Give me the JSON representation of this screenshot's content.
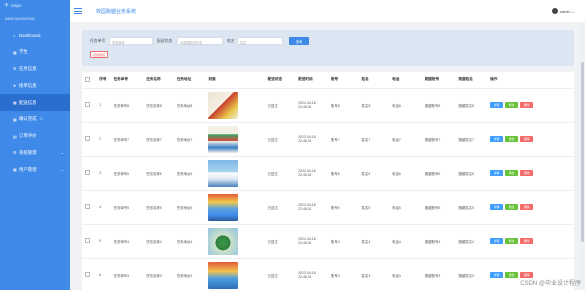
{
  "app": {
    "logo_text": "Sapo",
    "title": "校园跑腿业务系统",
    "user": "admin"
  },
  "sidebar": {
    "section_label": "MAIN NAVIGATION",
    "items": [
      {
        "label": "Dashboard",
        "icon": "home-icon"
      },
      {
        "label": "学生",
        "icon": "grid-icon"
      },
      {
        "label": "任务信息",
        "icon": "gear-icon"
      },
      {
        "label": "接单信息",
        "icon": "send-icon"
      },
      {
        "label": "配送信息",
        "icon": "grid-icon"
      },
      {
        "label": "确认完成",
        "icon": "grid-icon"
      },
      {
        "label": "订单评价",
        "icon": "doc-icon"
      },
      {
        "label": "系统管理",
        "icon": "gear-icon"
      },
      {
        "label": "用户管理",
        "icon": "grid-icon"
      }
    ]
  },
  "search": {
    "label_task_no": "任务单号",
    "placeholder_task_no": "任务单号",
    "label_delivery_status": "配送状态",
    "placeholder_delivery_status": "请选择配送状态",
    "label_name": "姓名",
    "placeholder_name": "姓名",
    "button": "查询",
    "delete_button": "批量删除"
  },
  "table": {
    "headers": [
      "序号",
      "任务单号",
      "任务名称",
      "任务地址",
      "封面",
      "配送状态",
      "配送时间",
      "账号",
      "姓名",
      "电话",
      "跑腿账号",
      "跑腿姓名",
      "操作"
    ],
    "rows": [
      {
        "idx": "1",
        "task_no": "任务单号8",
        "task_name": "任务名称8",
        "addr": "任务地址8",
        "status": "已送达",
        "time": "2022-04-18 22:46:31",
        "account": "账号8",
        "name": "姓名8",
        "phone": "电话8",
        "runner_acc": "跑腿账号8",
        "runner_name": "跑腿姓名8"
      },
      {
        "idx": "2",
        "task_no": "任务单号7",
        "task_name": "任务名称7",
        "addr": "任务地址7",
        "status": "已送达",
        "time": "2022-04-18 22:46:31",
        "account": "账号7",
        "name": "姓名7",
        "phone": "电话7",
        "runner_acc": "跑腿账号7",
        "runner_name": "跑腿姓名7"
      },
      {
        "idx": "3",
        "task_no": "任务单号6",
        "task_name": "任务名称6",
        "addr": "任务地址6",
        "status": "已送达",
        "time": "2022-04-18 22:46:31",
        "account": "账号6",
        "name": "姓名6",
        "phone": "电话6",
        "runner_acc": "跑腿账号6",
        "runner_name": "跑腿姓名6"
      },
      {
        "idx": "4",
        "task_no": "任务单号5",
        "task_name": "任务名称5",
        "addr": "任务地址5",
        "status": "已送达",
        "time": "2022-04-18 22:46:31",
        "account": "账号5",
        "name": "姓名5",
        "phone": "电话5",
        "runner_acc": "跑腿账号5",
        "runner_name": "跑腿姓名5"
      },
      {
        "idx": "5",
        "task_no": "任务单号4",
        "task_name": "任务名称4",
        "addr": "任务地址4",
        "status": "已送达",
        "time": "2022-04-18 22:46:31",
        "account": "账号4",
        "name": "姓名4",
        "phone": "电话4",
        "runner_acc": "跑腿账号4",
        "runner_name": "跑腿姓名4"
      },
      {
        "idx": "6",
        "task_no": "任务单号3",
        "task_name": "任务名称3",
        "addr": "任务地址3",
        "status": "已送达",
        "time": "2022-04-18 22:46:31",
        "account": "账号3",
        "name": "姓名3",
        "phone": "电话3",
        "runner_acc": "跑腿账号3",
        "runner_name": "跑腿姓名3"
      }
    ],
    "op_detail": "详情",
    "op_edit": "修改",
    "op_delete": "删除"
  },
  "watermark": "CSDN @毕业设计程序",
  "colors": {
    "sidebar": "#3f8ae8",
    "accent": "#409eff",
    "success": "#67c23a",
    "danger": "#f56c6c"
  }
}
